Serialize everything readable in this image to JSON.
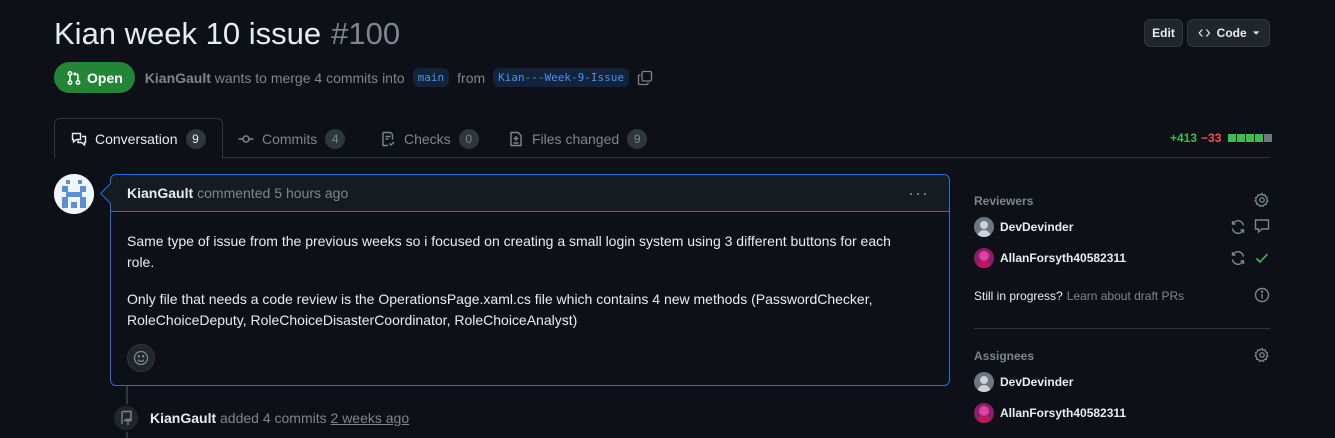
{
  "pr": {
    "title": "Kian week 10 issue",
    "number": "#100",
    "state": "Open",
    "author": "KianGault",
    "merge_text_mid": "wants to merge 4 commits into",
    "base_branch": "main",
    "from_label": "from",
    "head_branch": "Kian---Week-9-Issue"
  },
  "header_buttons": {
    "edit": "Edit",
    "code": "Code"
  },
  "tabs": [
    {
      "label": "Conversation",
      "count": "9"
    },
    {
      "label": "Commits",
      "count": "4"
    },
    {
      "label": "Checks",
      "count": "0"
    },
    {
      "label": "Files changed",
      "count": "9"
    }
  ],
  "diffstat": {
    "additions": "+413",
    "deletions": "−33",
    "colors": {
      "add": "#3fb950",
      "del": "#f85149",
      "neutral": "#6e7681"
    }
  },
  "comment": {
    "author": "KianGault",
    "action": "commented",
    "time": "5 hours ago",
    "body_p1": "Same type of issue from the previous weeks so i focused on creating a small login system using 3 different buttons for each role.",
    "body_p2": "Only file that needs a code review is the OperationsPage.xaml.cs file which contains 4 new methods (PasswordChecker, RoleChoiceDeputy, RoleChoiceDisasterCoordinator, RoleChoiceAnalyst)"
  },
  "event": {
    "author": "KianGault",
    "action": "added 4 commits",
    "time": "2 weeks ago"
  },
  "sidebar": {
    "reviewers_title": "Reviewers",
    "reviewers": [
      {
        "name": "DevDevinder",
        "status_icon": "comment-icon"
      },
      {
        "name": "AllanForsyth40582311",
        "status_icon": "check-icon"
      }
    ],
    "draft_question": "Still in progress?",
    "draft_link": "Learn about draft PRs",
    "assignees_title": "Assignees",
    "assignees": [
      {
        "name": "DevDevinder"
      },
      {
        "name": "AllanForsyth40582311"
      }
    ]
  },
  "colors": {
    "accent": "#1f6feb",
    "open_green": "#238636",
    "background": "#0d1117"
  }
}
